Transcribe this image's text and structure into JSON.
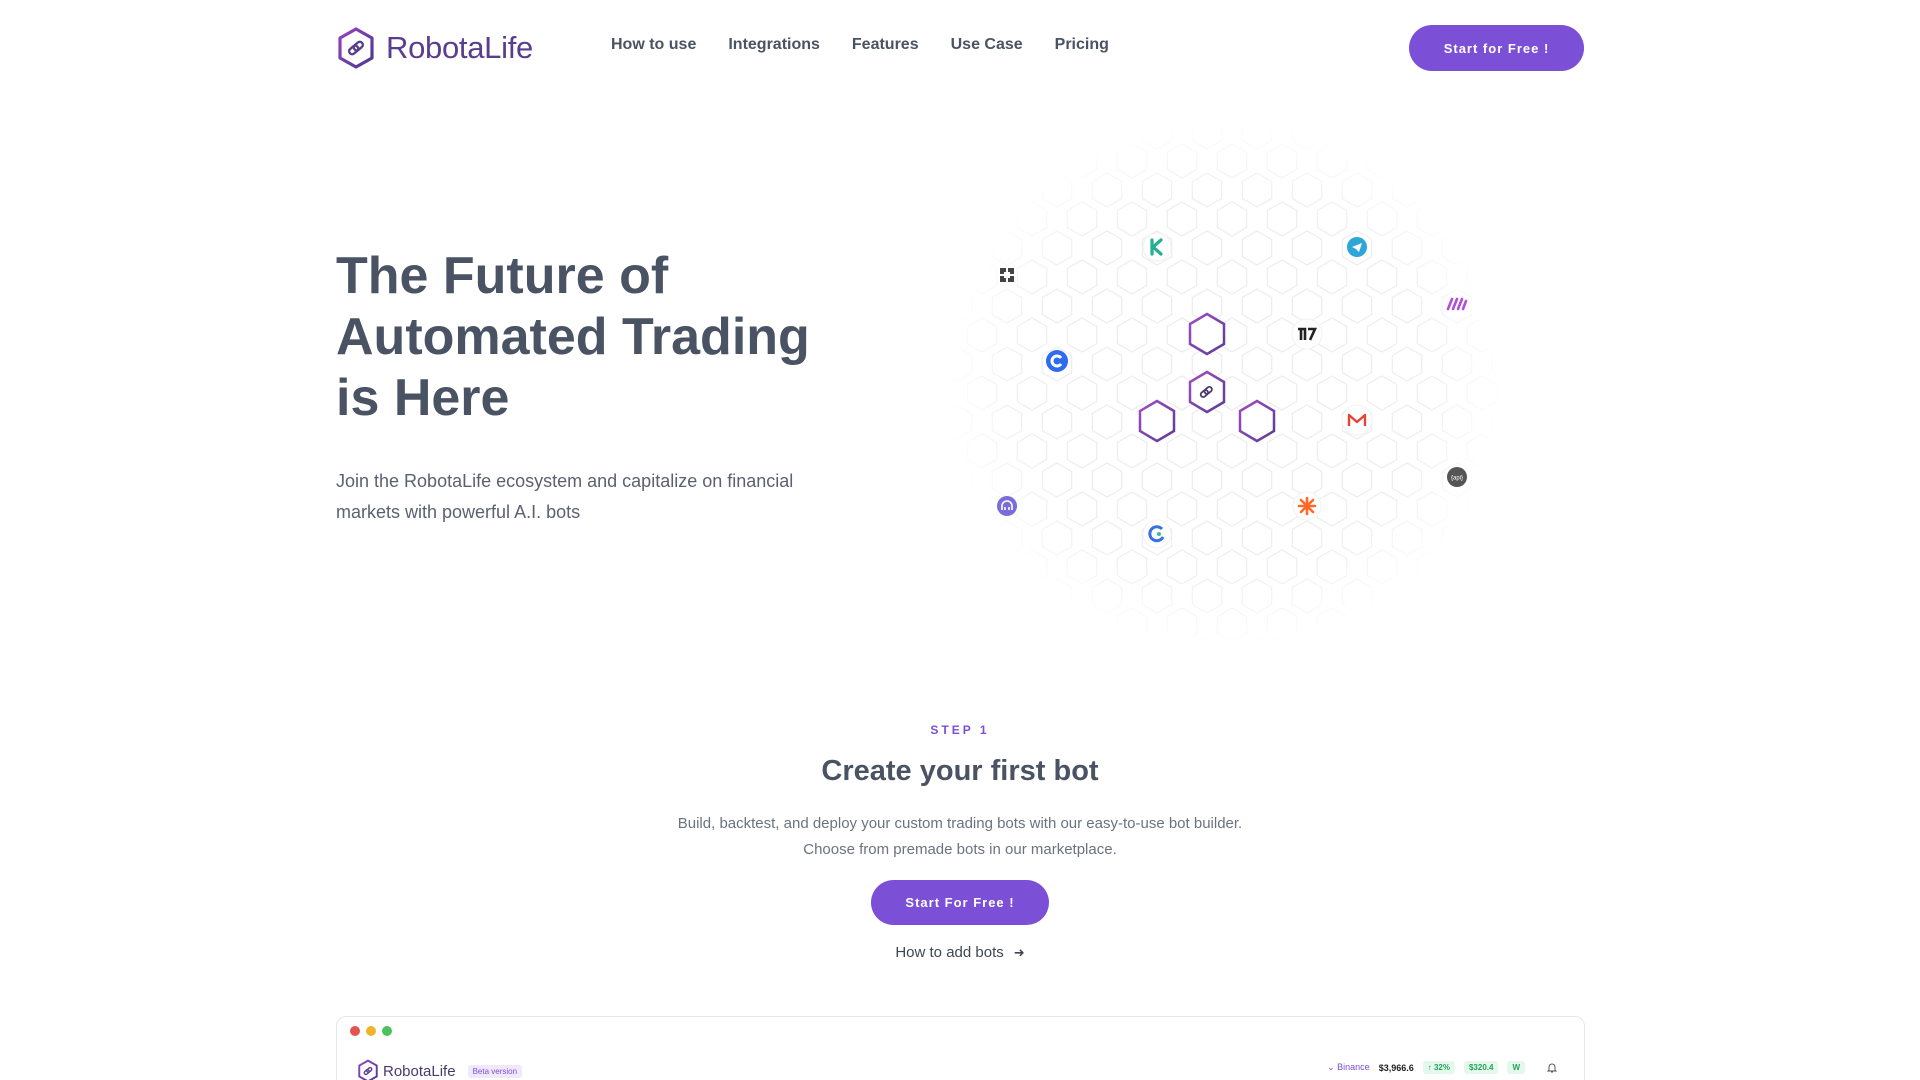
{
  "header": {
    "logo_text": "RobotaLife",
    "nav": [
      "How to use",
      "Integrations",
      "Features",
      "Use Case",
      "Pricing"
    ],
    "cta": "Start for Free !"
  },
  "hero": {
    "title_lines": [
      "The Future of",
      "Automated Trading",
      "is Here"
    ],
    "subtitle_lines": [
      "Join the RobotaLife ecosystem and capitalize on financial",
      "markets with powerful A.I. bots"
    ],
    "integration_icons": [
      "x-icon",
      "kucoin-icon",
      "telegram-icon",
      "make-icon",
      "tradingview-icon",
      "coinbase-icon",
      "gmail-icon",
      "api-icon",
      "kraken-icon",
      "zapier-icon",
      "gatorade-icon"
    ]
  },
  "step": {
    "label": "STEP 1",
    "title": "Create your first bot",
    "desc_lines": [
      "Build, backtest, and deploy your custom trading bots with our easy-to-use bot builder.",
      "Choose from premade bots in our marketplace."
    ],
    "cta": "Start For Free !",
    "link": "How to add bots",
    "link_arrow": "➜"
  },
  "preview": {
    "logo_text": "RobotaLife",
    "beta": "Beta version",
    "exchange": "Binance",
    "chevron": "⌄",
    "price": "$3,966.6",
    "change": "↑ 32%",
    "value": "$320.4",
    "badge": "W"
  },
  "colors": {
    "accent": "#7b4fd6",
    "text": "#4a5363",
    "dot_red": "#e4534f",
    "dot_yellow": "#f0b429",
    "dot_green": "#4cc15e"
  }
}
